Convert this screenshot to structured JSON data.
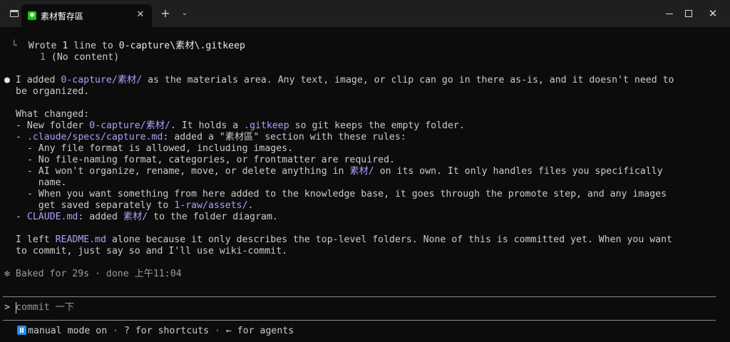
{
  "window": {
    "tab_title": "素材暫存區",
    "tab_icon_glyph": "✱",
    "close_tab_glyph": "✕",
    "new_tab_glyph": "+",
    "dropdown_glyph": "⌄",
    "minimize_glyph": "—",
    "maximize_glyph": "☐",
    "close_window_glyph": "✕"
  },
  "tool_result": {
    "prefix": "  └  ",
    "verb": "Wrote ",
    "count": "1",
    "mid": " line to ",
    "path": "0-capture\\素材\\.gitkeep",
    "line_no": "1",
    "content": "(No content)"
  },
  "message": {
    "bullet": "●",
    "p1a_pre": " I added ",
    "p1a_path": "0-capture/素材/",
    "p1a_post": " as the materials area. Any text, image, or clip can go in there as-is, and it doesn't need to",
    "p1b": "be organized.",
    "what_changed": "What changed:",
    "c1_pre": "- New folder ",
    "c1_path": "0-capture/素材/",
    "c1_mid": ". It holds a ",
    "c1_file": ".gitkeep",
    "c1_post": " so git keeps the empty folder.",
    "c2_pre": "- ",
    "c2_file": ".claude/specs/capture.md",
    "c2_post": ": added a \"素材區\" section with these rules:",
    "r1": "  - Any file format is allowed, including images.",
    "r2": "  - No file-naming format, categories, or frontmatter are required.",
    "r3_pre": "  - AI won't organize, rename, move, or delete anything in ",
    "r3_path": "素材/",
    "r3_post": " on its own. It only handles files you specifically",
    "r3b": "    name.",
    "r4a": "  - When you want something from here added to the knowledge base, it goes through the promote step, and any images",
    "r4b_pre": "    get saved separately to ",
    "r4b_path": "1-raw/assets/",
    "r4b_post": ".",
    "c3_pre": "- ",
    "c3_file": "CLAUDE.md",
    "c3_mid": ": added ",
    "c3_path": "素材/",
    "c3_post": " to the folder diagram.",
    "p2a_pre": "I left ",
    "p2a_file": "README.md",
    "p2a_post": " alone because it only describes the top-level folders. None of this is committed yet. When you want",
    "p2b": "to commit, just say so and I'll use wiki-commit."
  },
  "status": {
    "glyph": "✻",
    "text": " Baked for 29s · done 上午11:04"
  },
  "prompt": {
    "caret": ">",
    "placeholder": "commit 一下"
  },
  "footer": {
    "mode": "manual mode on",
    "sep1": " · ",
    "shortcuts": "? for shortcuts",
    "sep2": " · ",
    "agents": "← for agents"
  },
  "colors": {
    "background": "#0c0c0c",
    "titlebar": "#1f1f1f",
    "text": "#cccccc",
    "highlight": "#a7a3f7",
    "mode_badge": "#1e90ff"
  }
}
